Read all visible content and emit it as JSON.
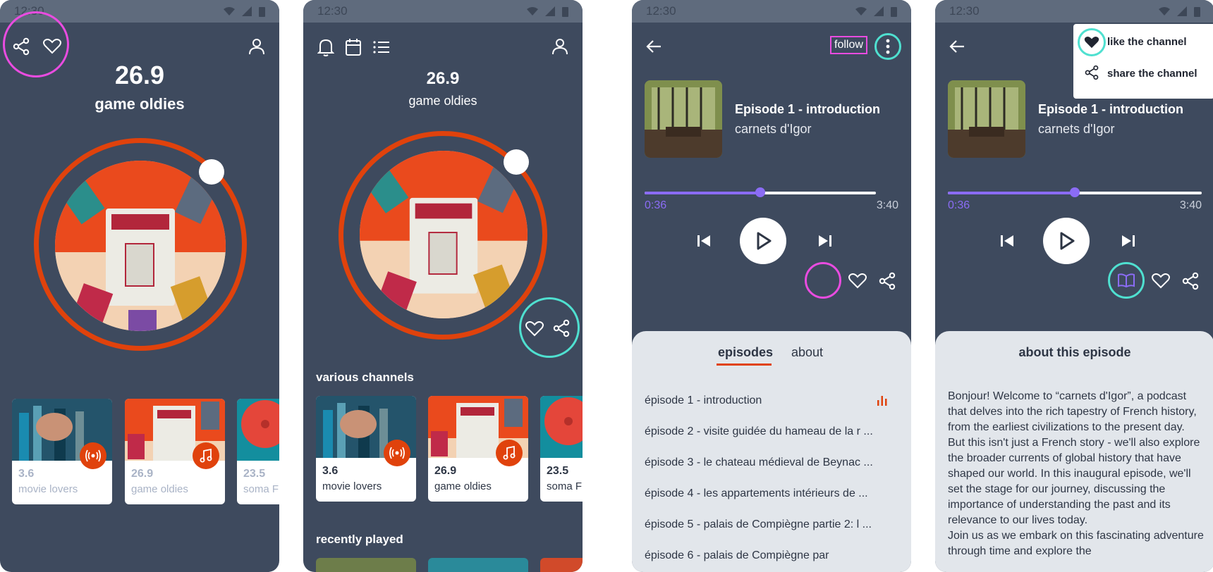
{
  "status": {
    "time": "12:30"
  },
  "colors": {
    "bg": "#3e4a5e",
    "accent": "#e0420c",
    "progress": "#8b6cf5",
    "highlight_pink": "#e94ce0",
    "highlight_teal": "#4fe0d0"
  },
  "screen1": {
    "frequency": "26.9",
    "channel_name": "game oldies",
    "icons": [
      "share-icon",
      "heart-icon",
      "user-icon"
    ],
    "cards": [
      {
        "freq": "3.6",
        "name": "movie lovers",
        "badge": "broadcast-icon"
      },
      {
        "freq": "26.9",
        "name": "game oldies",
        "badge": "music-note-icon"
      },
      {
        "freq": "23.5",
        "name": "soma F"
      }
    ]
  },
  "screen2": {
    "frequency": "26.9",
    "channel_name": "game oldies",
    "icons": [
      "bell-icon",
      "calendar-icon",
      "list-icon",
      "user-icon",
      "heart-icon",
      "share-icon"
    ],
    "section_channels": "various channels",
    "section_recent": "recently played",
    "cards": [
      {
        "freq": "3.6",
        "name": "movie lovers",
        "badge": "broadcast-icon"
      },
      {
        "freq": "26.9",
        "name": "game oldies",
        "badge": "music-note-icon"
      },
      {
        "freq": "23.5",
        "name": "soma FM"
      }
    ]
  },
  "screen3": {
    "follow_label": "follow",
    "episode_title": "Episode 1 - introduction",
    "podcast_name": "carnets d'Igor",
    "time_current": "0:36",
    "time_total": "3:40",
    "progress": 0.5,
    "tabs": [
      "episodes",
      "about"
    ],
    "episodes": [
      "épisode 1 - introduction",
      "épisode 2 - visite guidée du hameau de la r ...",
      "épisode 3 - le chateau médieval de Beynac ...",
      "épisode 4 - les appartements intérieurs de ...",
      "épisode 5 - palais de Compiègne partie 2: l ...",
      "épisode 6 - palais de Compiègne par"
    ]
  },
  "screen4": {
    "episode_title": "Episode 1 - introduction",
    "podcast_name": "carnets d'Igor",
    "time_current": "0:36",
    "time_total": "3:40",
    "progress": 0.5,
    "menu": {
      "like": "like the channel",
      "share": "share the channel"
    },
    "about_title": "about this episode",
    "about_p1": "Bonjour! Welcome to “carnets d'Igor”, a podcast that delves into the rich tapestry of French history, from the earliest civilizations to the present day. But this isn't just a French story - we'll also explore the broader currents of global history that have shaped our world. In this inaugural episode, we'll set the stage for our journey, discussing the importance of understanding the past and its relevance to our lives today.",
    "about_p2": "Join us as we embark on this fascinating adventure through time and explore the"
  }
}
